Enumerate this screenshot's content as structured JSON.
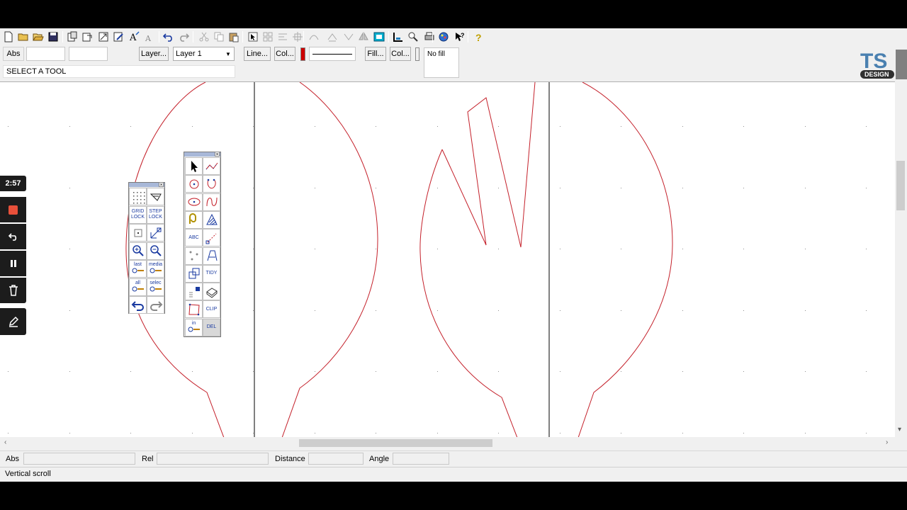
{
  "toolbar": {
    "icons": [
      "new-icon",
      "open-icon",
      "open-folder-icon",
      "save-icon",
      "import-icon",
      "export-icon",
      "resize-icon",
      "edit-icon",
      "text-icon",
      "text-small-icon",
      "undo-icon",
      "redo-icon",
      "cut-icon",
      "copy-icon",
      "paste-icon",
      "select-icon",
      "array-icon",
      "align-icon",
      "move-icon",
      "arc-icon",
      "layer-up-icon",
      "layer-down-icon",
      "flip-icon",
      "frame-icon",
      "measure-icon",
      "zoom-icon",
      "print-icon",
      "palette-icon",
      "help-pointer-icon",
      "help-icon"
    ]
  },
  "controls": {
    "abs_label": "Abs",
    "layer_button": "Layer...",
    "layer_select": "Layer 1",
    "line_button": "Line...",
    "line_color_button": "Col...",
    "fill_button": "Fill...",
    "fill_color_button": "Col...",
    "fill_value": "No fill",
    "hint": "SELECT A TOOL",
    "line_color": "#cc0000"
  },
  "logo": {
    "text": "TS",
    "sub": "DESIGN"
  },
  "palette_left": {
    "tools": [
      {
        "name": "grid-icon",
        "label": ""
      },
      {
        "name": "view-icon",
        "label": ""
      },
      {
        "name": "grid-lock-button",
        "label": "GRID\nLOCK"
      },
      {
        "name": "step-lock-button",
        "label": "STEP\nLOCK"
      },
      {
        "name": "point-icon",
        "label": ""
      },
      {
        "name": "scale-icon",
        "label": ""
      },
      {
        "name": "zoom-in-icon",
        "label": ""
      },
      {
        "name": "zoom-out-icon",
        "label": ""
      },
      {
        "name": "zoom-last-button",
        "label": "last"
      },
      {
        "name": "zoom-media-button",
        "label": "media"
      },
      {
        "name": "zoom-all-button",
        "label": "all"
      },
      {
        "name": "zoom-select-button",
        "label": "selec"
      },
      {
        "name": "undo-icon",
        "label": ""
      },
      {
        "name": "redo-icon",
        "label": ""
      }
    ]
  },
  "palette_right": {
    "tools": [
      {
        "name": "pointer-icon",
        "label": ""
      },
      {
        "name": "polyline-icon",
        "label": ""
      },
      {
        "name": "circle-icon",
        "label": ""
      },
      {
        "name": "arc-icon",
        "label": ""
      },
      {
        "name": "ellipse-icon",
        "label": ""
      },
      {
        "name": "curve-icon",
        "label": ""
      },
      {
        "name": "offset-icon",
        "label": ""
      },
      {
        "name": "hatch-icon",
        "label": ""
      },
      {
        "name": "text-tool-button",
        "label": "ABC"
      },
      {
        "name": "measure-icon",
        "label": ""
      },
      {
        "name": "nodes-icon",
        "label": ""
      },
      {
        "name": "path-icon",
        "label": ""
      },
      {
        "name": "copy-shape-icon",
        "label": ""
      },
      {
        "name": "tidy-button",
        "label": "TIDY"
      },
      {
        "name": "color-fill-icon",
        "label": ""
      },
      {
        "name": "extrude-icon",
        "label": ""
      },
      {
        "name": "bezier-icon",
        "label": ""
      },
      {
        "name": "clip-button",
        "label": "CLIP"
      },
      {
        "name": "zoom-in-button",
        "label": "in"
      },
      {
        "name": "delete-button",
        "label": "DEL"
      }
    ]
  },
  "status": {
    "abs_label": "Abs",
    "rel_label": "Rel",
    "distance_label": "Distance",
    "angle_label": "Angle",
    "message": "Vertical scroll"
  },
  "recorder": {
    "timer": "2:57",
    "icons": [
      "record-stop-icon",
      "undo-icon",
      "pause-icon",
      "trash-icon",
      "pen-icon"
    ]
  }
}
